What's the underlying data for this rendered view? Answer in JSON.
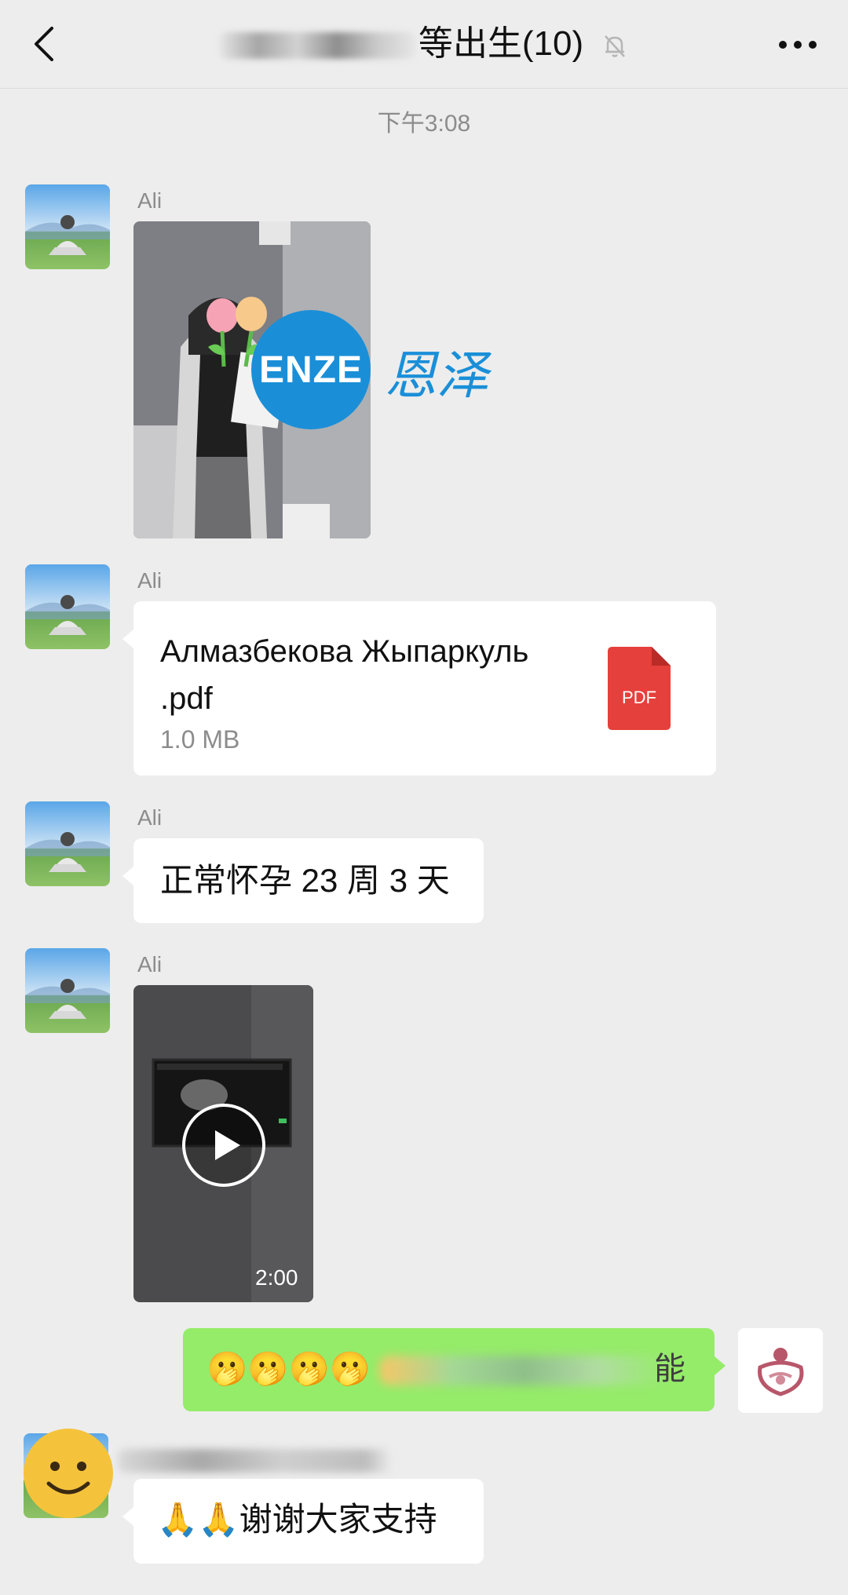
{
  "header": {
    "title": "等出生(10)"
  },
  "timestamp": "下午3:08",
  "messages": [
    {
      "sender": "Ali",
      "type": "image"
    },
    {
      "sender": "Ali",
      "type": "file",
      "file_name": "Алмазбекова Жыпаркуль .pdf",
      "file_size": "1.0 MB",
      "file_badge": "PDF"
    },
    {
      "sender": "Ali",
      "type": "text",
      "text": "正常怀孕 23 周 3 天"
    },
    {
      "sender": "Ali",
      "type": "video",
      "duration": "2:00"
    },
    {
      "sender": "self",
      "type": "text",
      "text": "🫢🫢🫢🫢",
      "tail": "能"
    },
    {
      "type": "text",
      "text": "🙏🙏谢谢大家支持"
    }
  ],
  "watermark": {
    "logo_text": "ENZE",
    "text": "恩泽"
  },
  "colors": {
    "bubble_self": "#95ec69",
    "bubble_other": "#ffffff",
    "background": "#ededed",
    "pdf_red": "#e5403b",
    "watermark_blue": "#1a8fd8"
  }
}
